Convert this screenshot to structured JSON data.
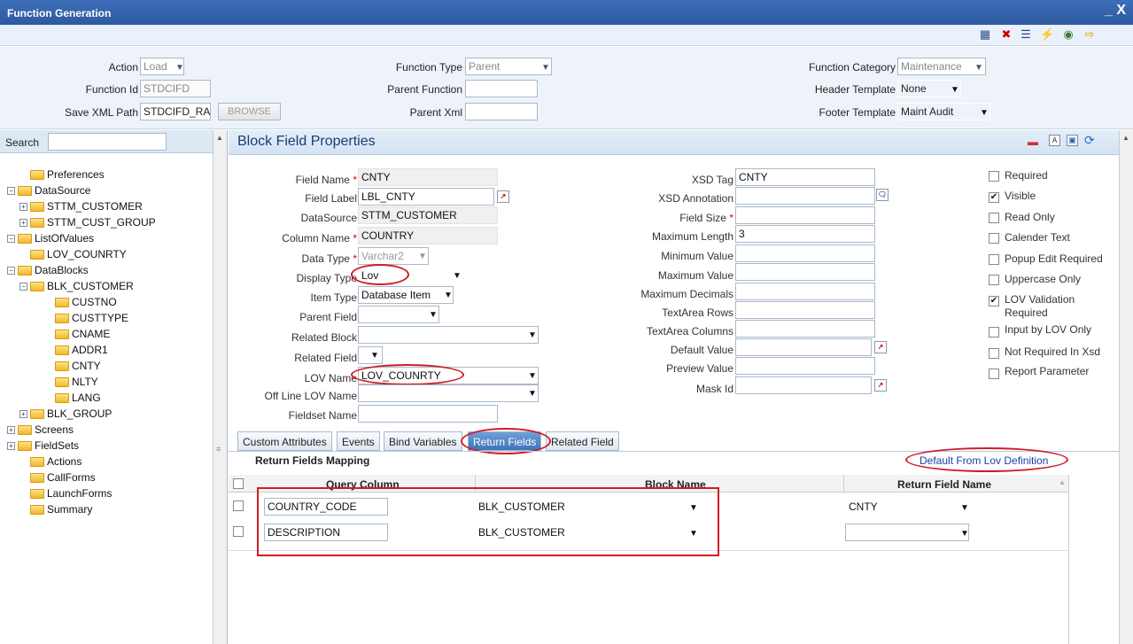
{
  "window": {
    "title": "Function Generation",
    "controls": "_ X"
  },
  "toolbar": {
    "icons": [
      "save-icon",
      "delete-icon",
      "list-icon",
      "generate-icon",
      "deploy-icon",
      "exit-icon"
    ]
  },
  "header": {
    "action": {
      "label": "Action",
      "value": "Load"
    },
    "function_id": {
      "label": "Function Id",
      "value": "STDCIFD"
    },
    "save_xml_path": {
      "label": "Save XML Path",
      "value": "STDCIFD_RAI",
      "browse_label": "BROWSE"
    },
    "function_type": {
      "label": "Function Type",
      "value": "Parent"
    },
    "parent_function": {
      "label": "Parent Function",
      "value": ""
    },
    "parent_xml": {
      "label": "Parent Xml",
      "value": ""
    },
    "function_category": {
      "label": "Function Category",
      "value": "Maintenance"
    },
    "header_template": {
      "label": "Header Template",
      "value": "None"
    },
    "footer_template": {
      "label": "Footer Template",
      "value": "Maint Audit"
    }
  },
  "sidebar": {
    "search_label": "Search",
    "tree": {
      "preferences": "Preferences",
      "datasource": "DataSource",
      "stm_customer": "STTM_CUSTOMER",
      "stm_cust_group": "STTM_CUST_GROUP",
      "listofvalues": "ListOfValues",
      "lov_counrty": "LOV_COUNRTY",
      "datablocks": "DataBlocks",
      "blk_customer": "BLK_CUSTOMER",
      "custno": "CUSTNO",
      "custtype": "CUSTTYPE",
      "cname": "CNAME",
      "addr1": "ADDR1",
      "cnty": "CNTY",
      "nlty": "NLTY",
      "lang": "LANG",
      "blk_group": "BLK_GROUP",
      "screens": "Screens",
      "fieldsets": "FieldSets",
      "actions": "Actions",
      "callforms": "CallForms",
      "launchforms": "LaunchForms",
      "summary": "Summary"
    }
  },
  "block": {
    "title": "Block Field Properties",
    "fields_left": {
      "field_name": {
        "label": "Field Name",
        "value": "CNTY"
      },
      "field_label": {
        "label": "Field Label",
        "value": "LBL_CNTY"
      },
      "datasource": {
        "label": "DataSource",
        "value": "STTM_CUSTOMER"
      },
      "column_name": {
        "label": "Column Name",
        "value": "COUNTRY"
      },
      "data_type": {
        "label": "Data Type",
        "value": "Varchar2"
      },
      "display_type": {
        "label": "Display Type",
        "value": "Lov"
      },
      "item_type": {
        "label": "Item Type",
        "value": "Database Item"
      },
      "parent_field": {
        "label": "Parent Field",
        "value": ""
      },
      "related_block": {
        "label": "Related Block",
        "value": ""
      },
      "related_field": {
        "label": "Related Field",
        "value": ""
      },
      "lov_name": {
        "label": "LOV Name",
        "value": "LOV_COUNRTY"
      },
      "offline_lov_name": {
        "label": "Off Line LOV Name",
        "value": ""
      },
      "fieldset_name": {
        "label": "Fieldset Name",
        "value": ""
      }
    },
    "fields_mid": {
      "xsd_tag": {
        "label": "XSD Tag",
        "value": "CNTY"
      },
      "xsd_annotation": {
        "label": "XSD Annotation",
        "value": ""
      },
      "field_size": {
        "label": "Field Size",
        "value": ""
      },
      "maximum_length": {
        "label": "Maximum Length",
        "value": "3"
      },
      "minimum_value": {
        "label": "Minimum Value",
        "value": ""
      },
      "maximum_value": {
        "label": "Maximum Value",
        "value": ""
      },
      "maximum_decimals": {
        "label": "Maximum Decimals",
        "value": ""
      },
      "textarea_rows": {
        "label": "TextArea Rows",
        "value": ""
      },
      "textarea_columns": {
        "label": "TextArea Columns",
        "value": ""
      },
      "default_value": {
        "label": "Default Value",
        "value": ""
      },
      "preview_value": {
        "label": "Preview Value",
        "value": ""
      },
      "mask_id": {
        "label": "Mask Id",
        "value": ""
      }
    },
    "checkboxes": {
      "required": {
        "label": "Required",
        "checked": false
      },
      "visible": {
        "label": "Visible",
        "checked": true
      },
      "read_only": {
        "label": "Read Only",
        "checked": false
      },
      "calender_text": {
        "label": "Calender Text",
        "checked": false
      },
      "popup_edit_required": {
        "label": "Popup Edit Required",
        "checked": false
      },
      "uppercase_only": {
        "label": "Uppercase Only",
        "checked": false
      },
      "lov_validation": {
        "label": "LOV Validation",
        "label2": "Required",
        "checked": true
      },
      "input_by_lov_only": {
        "label": "Input by LOV Only",
        "checked": false
      },
      "not_required_in_xsd": {
        "label": "Not Required In Xsd",
        "checked": false
      },
      "report_parameter": {
        "label": "Report Parameter",
        "checked": false
      }
    },
    "check_mark": "✔",
    "tabs": {
      "custom_attributes": "Custom Attributes",
      "events": "Events",
      "bind_variables": "Bind Variables",
      "return_fields": "Return Fields",
      "related_field": "Related Field"
    },
    "return_fields": {
      "title": "Return Fields Mapping",
      "default_link": "Default From Lov Definition",
      "columns": {
        "query_column": "Query Column",
        "block_name": "Block Name",
        "return_field_name": "Return Field Name"
      },
      "rows": [
        {
          "query_column": "COUNTRY_CODE",
          "block_name": "BLK_CUSTOMER",
          "return_field_name": "CNTY"
        },
        {
          "query_column": "DESCRIPTION",
          "block_name": "BLK_CUSTOMER",
          "return_field_name": ""
        }
      ]
    }
  },
  "colors": {
    "titlebar": "#2d5aa0",
    "highlight": "#d01c28",
    "link": "#1a3fa8"
  }
}
